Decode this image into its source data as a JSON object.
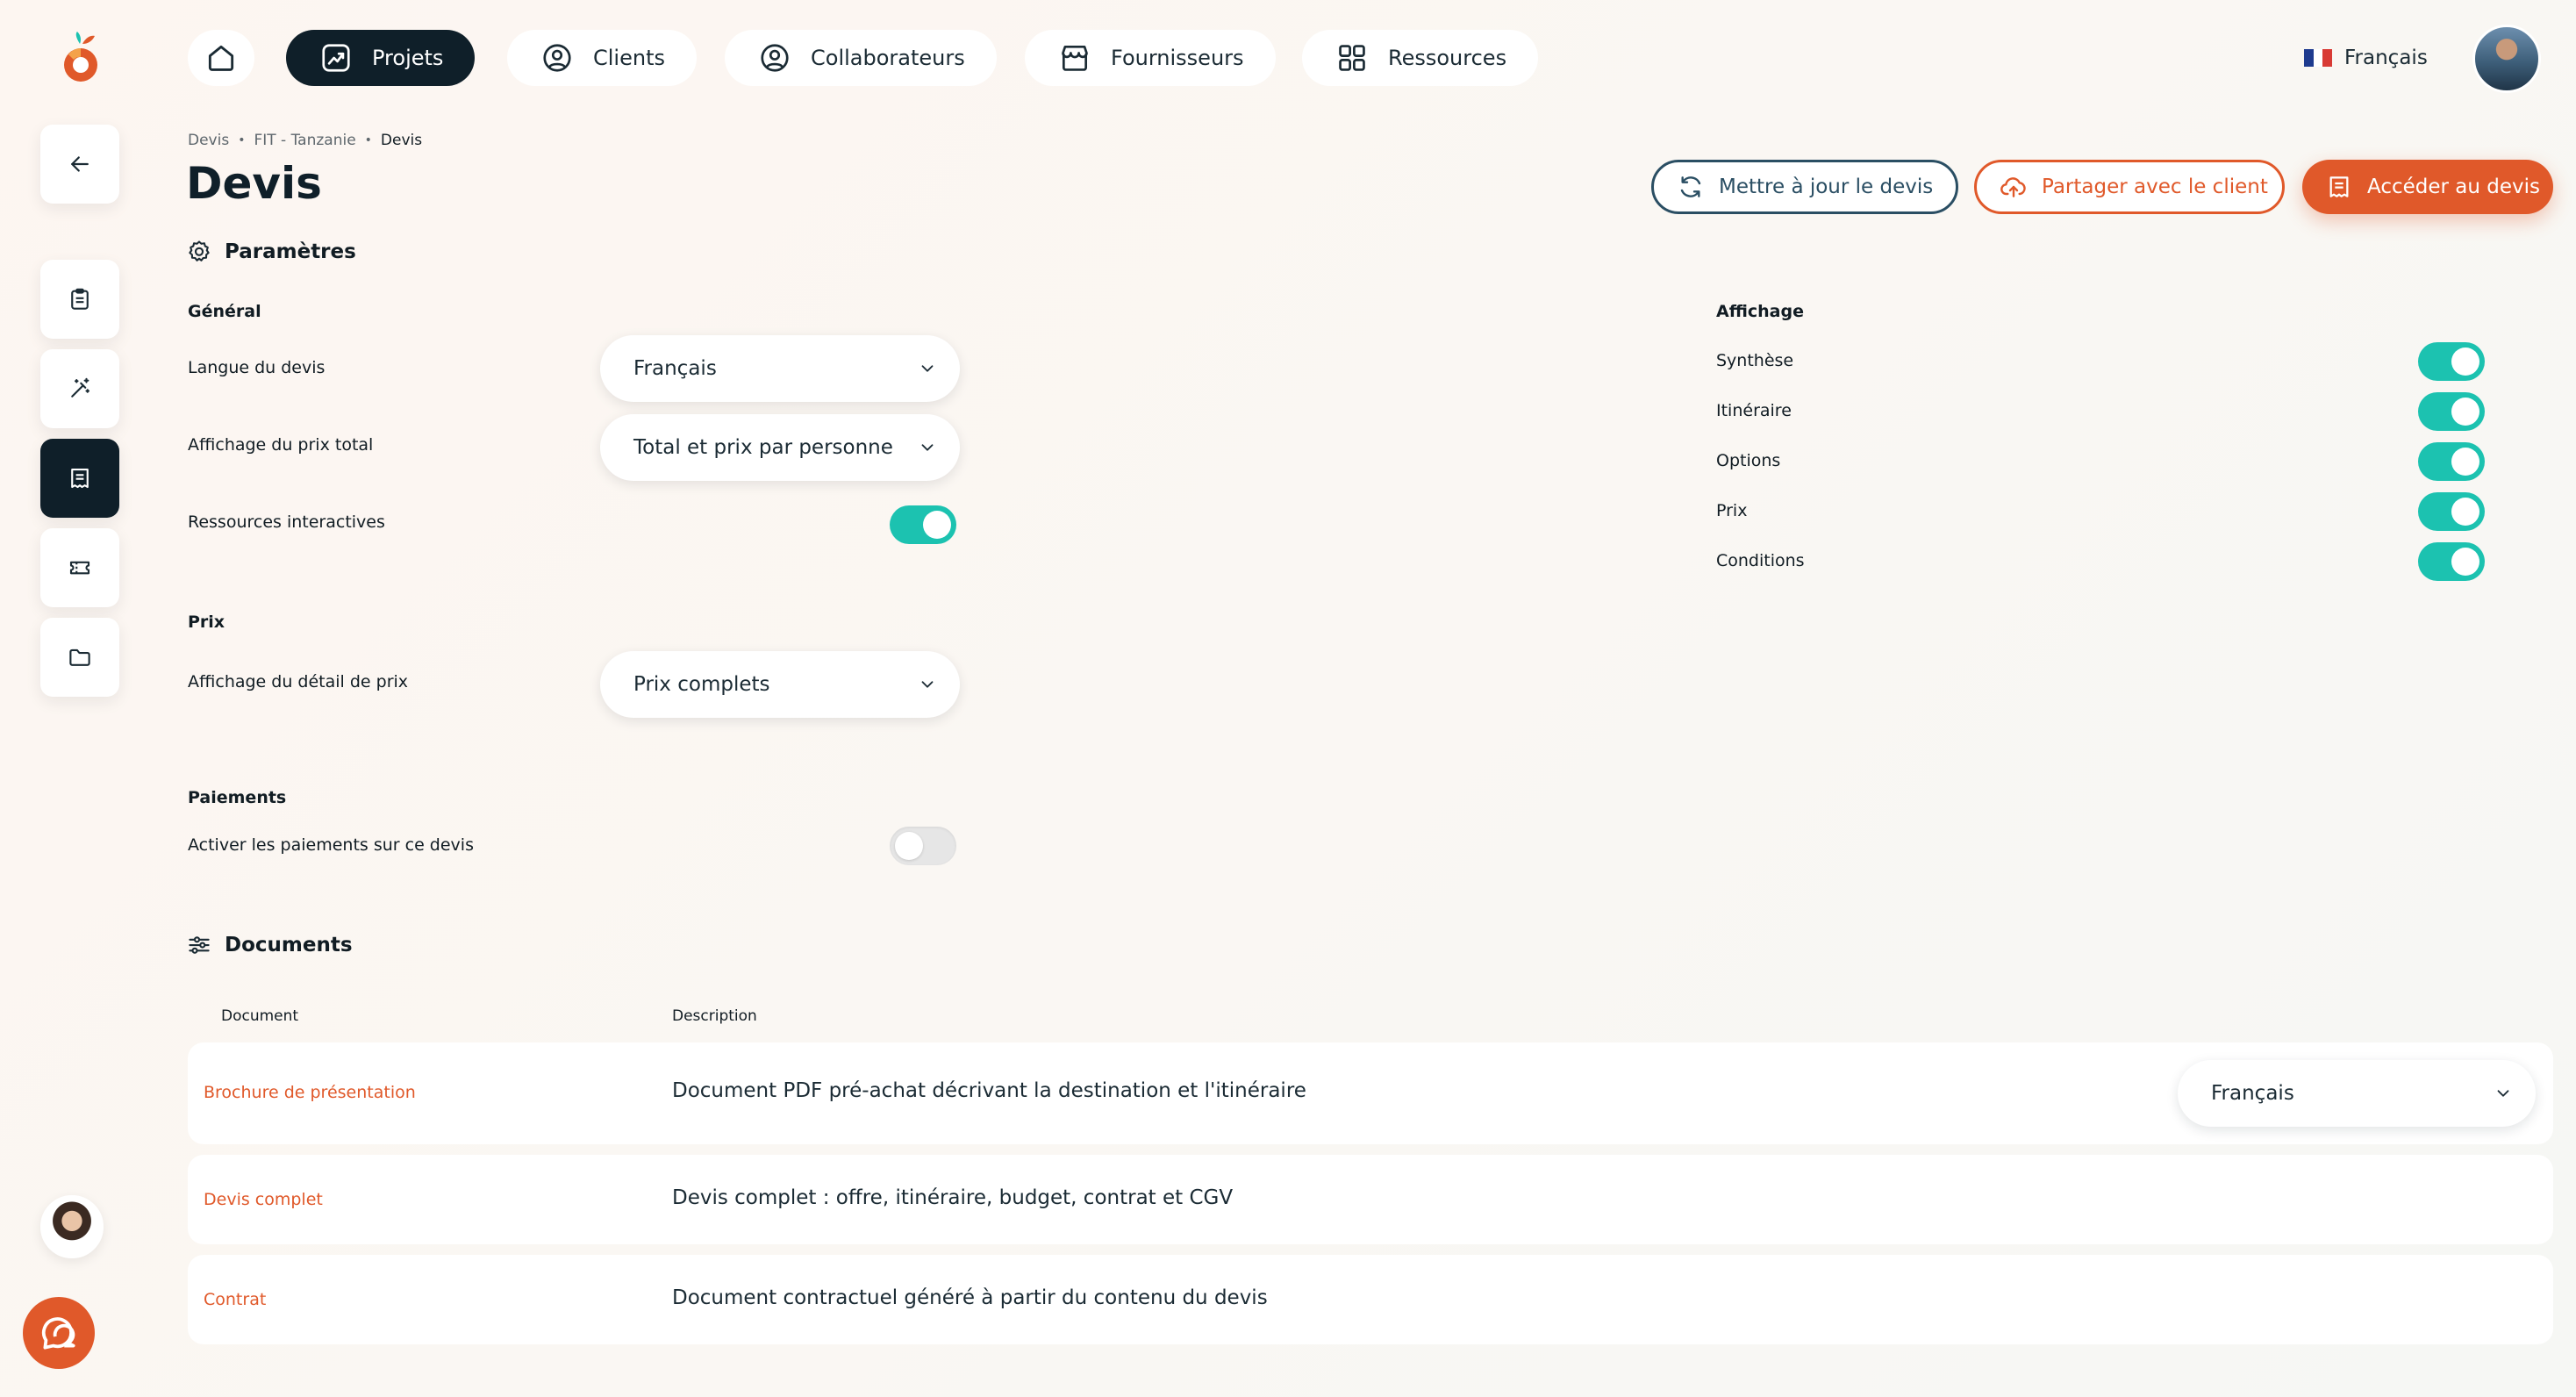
{
  "nav": {
    "home_label": "",
    "items": [
      {
        "label": "Projets",
        "icon": "projects-icon"
      },
      {
        "label": "Clients",
        "icon": "user-circle-icon"
      },
      {
        "label": "Collaborateurs",
        "icon": "user-circle-icon"
      },
      {
        "label": "Fournisseurs",
        "icon": "store-icon"
      },
      {
        "label": "Ressources",
        "icon": "grid-icon"
      }
    ],
    "language": "Français"
  },
  "sidebar": {
    "items": [
      "back-arrow-icon",
      "clipboard-icon",
      "magic-wand-icon",
      "quote-icon",
      "ticket-icon",
      "folder-icon"
    ]
  },
  "breadcrumb": [
    "Devis",
    "FIT - Tanzanie",
    "Devis"
  ],
  "page_title": "Devis",
  "actions": {
    "update": "Mettre à jour le devis",
    "share": "Partager avec le client",
    "access": "Accéder au devis"
  },
  "params": {
    "title": "Paramètres",
    "general": {
      "title": "Général",
      "language_label": "Langue du devis",
      "language_value": "Français",
      "price_display_label": "Affichage du prix total",
      "price_display_value": "Total et prix par personne",
      "interactive_label": "Ressources interactives",
      "interactive_on": true
    },
    "prix": {
      "title": "Prix",
      "detail_label": "Affichage du détail de prix",
      "detail_value": "Prix complets"
    },
    "paiements": {
      "title": "Paiements",
      "enable_label": "Activer les paiements sur ce devis",
      "enable_on": false
    },
    "affichage": {
      "title": "Affichage",
      "items": [
        {
          "label": "Synthèse",
          "on": true
        },
        {
          "label": "Itinéraire",
          "on": true
        },
        {
          "label": "Options",
          "on": true
        },
        {
          "label": "Prix",
          "on": true
        },
        {
          "label": "Conditions",
          "on": true
        }
      ]
    }
  },
  "documents": {
    "title": "Documents",
    "col_document": "Document",
    "col_description": "Description",
    "rows": [
      {
        "name": "Brochure de présentation",
        "description": "Document PDF pré-achat décrivant la destination et l'itinéraire",
        "language": "Français"
      },
      {
        "name": "Devis complet",
        "description": "Devis complet : offre, itinéraire, budget, contrat et CGV"
      },
      {
        "name": "Contrat",
        "description": "Document contractuel généré à partir du contenu du devis"
      }
    ]
  },
  "colors": {
    "accent": "#e0592a",
    "dark": "#0f1f29",
    "toggle_on": "#1cc2b0",
    "update_border": "#2a4e63"
  }
}
